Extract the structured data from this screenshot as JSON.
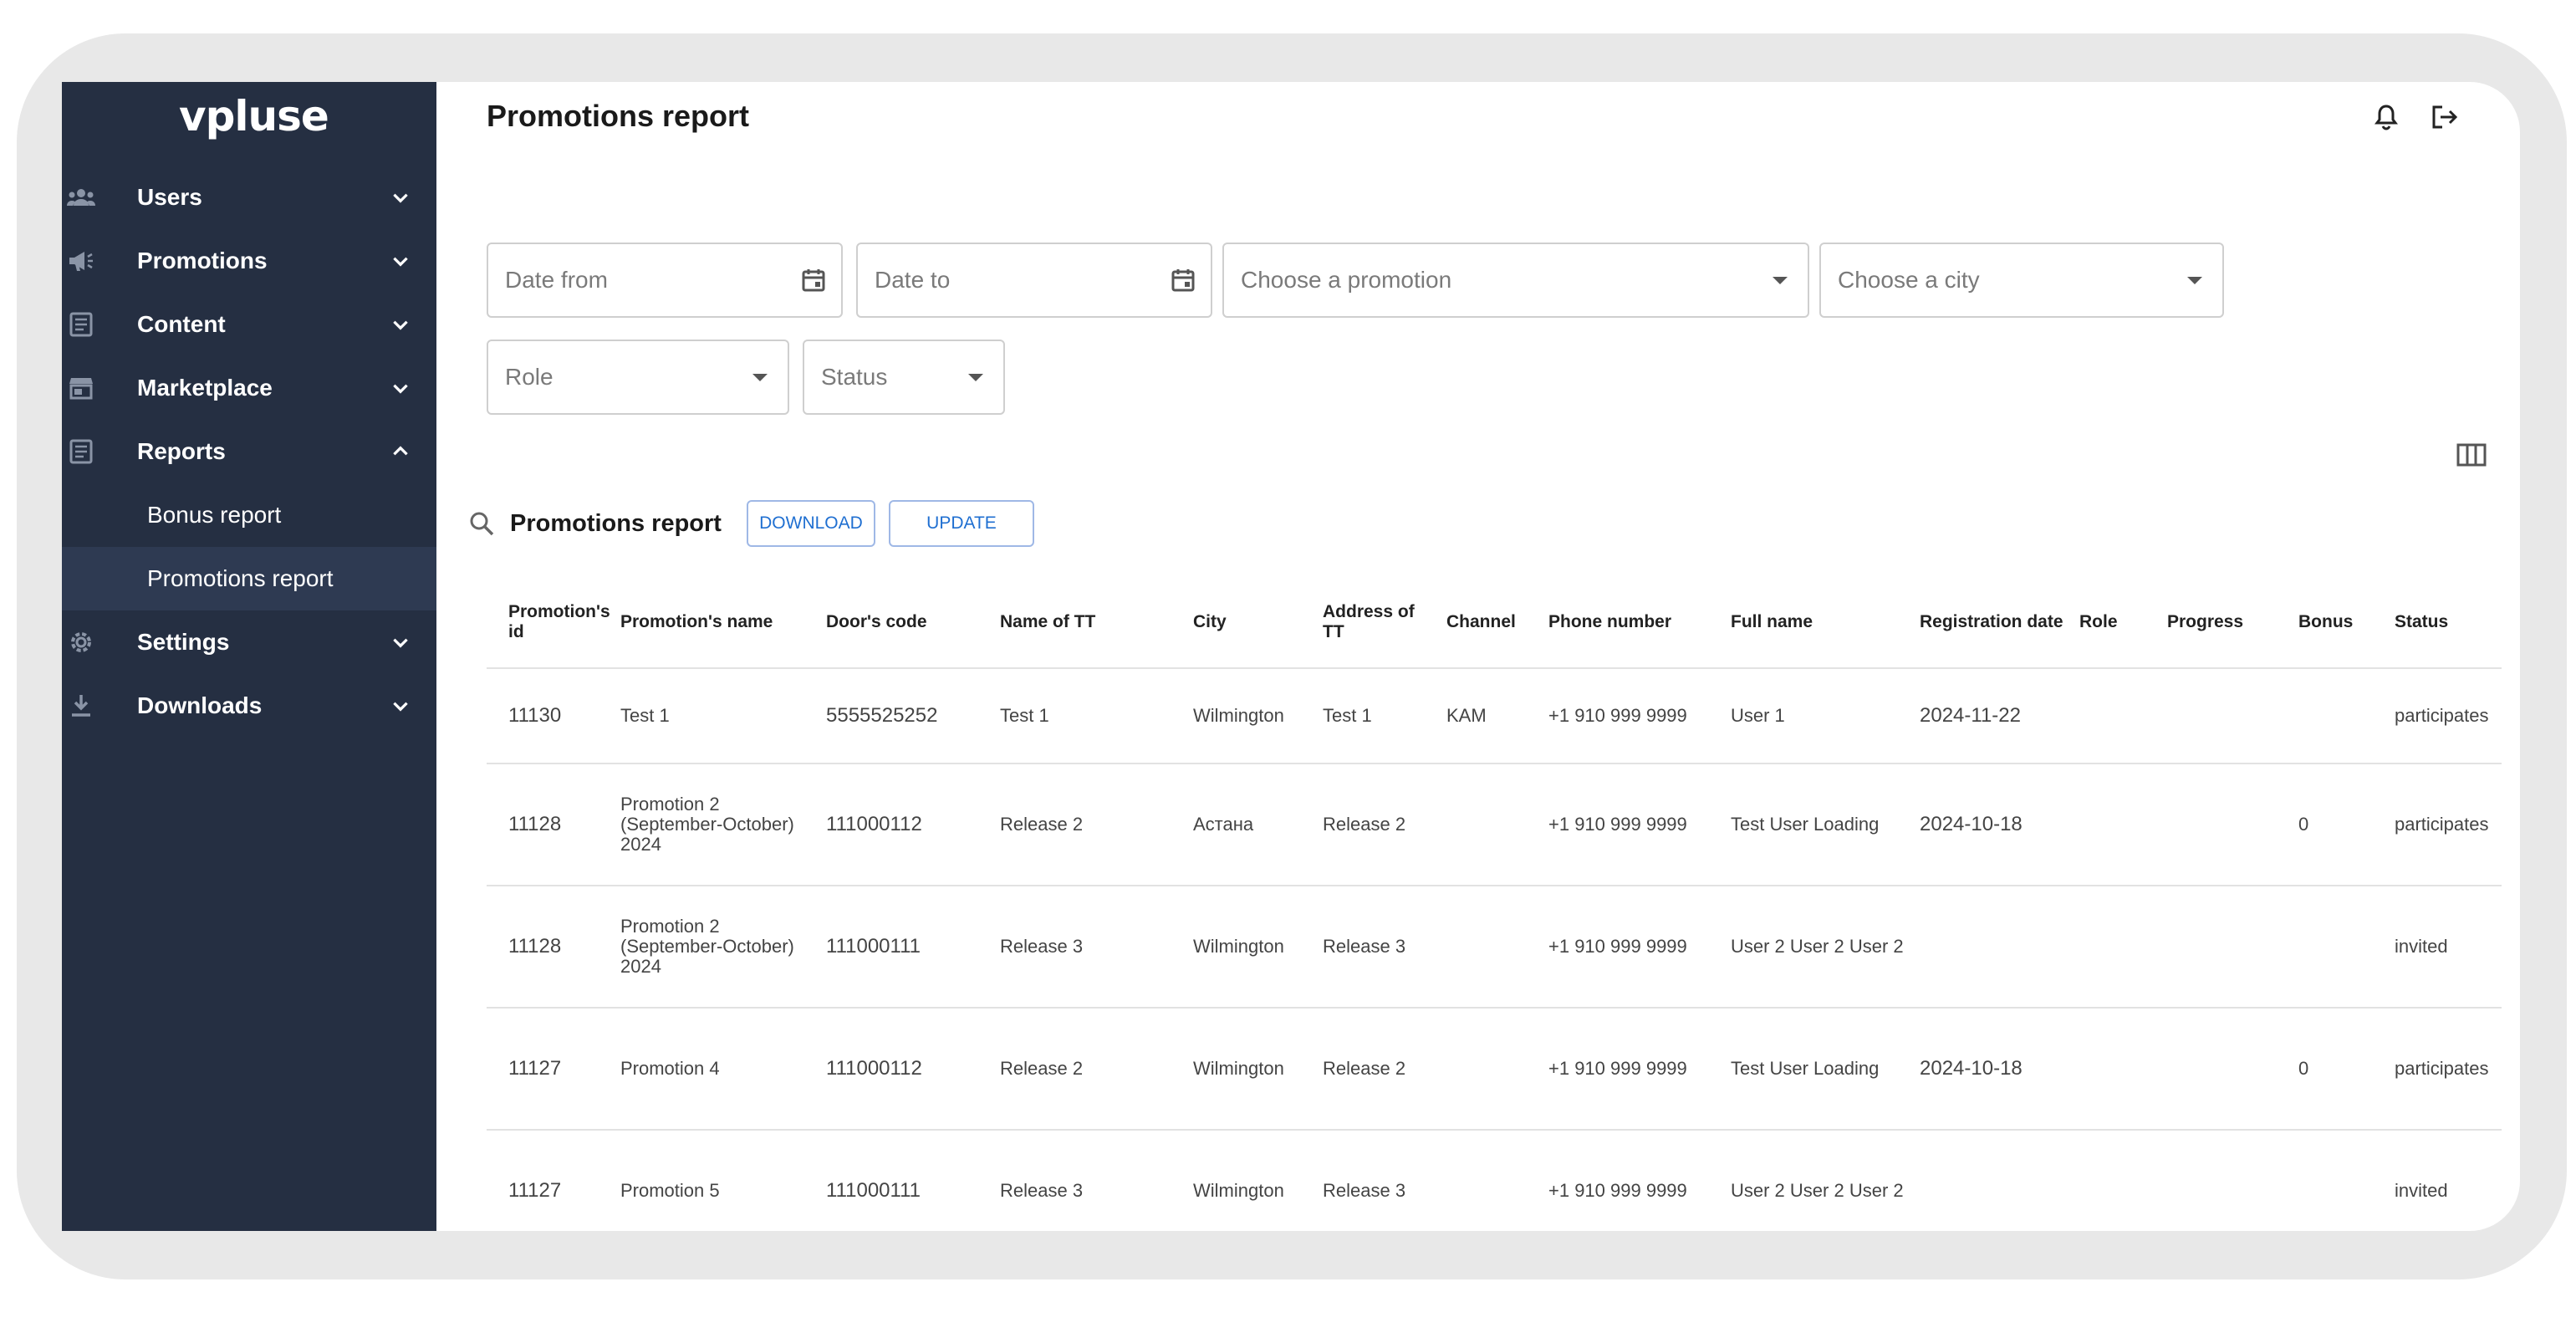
{
  "brand": {
    "logo": "vpluse"
  },
  "sidebar": {
    "items": [
      {
        "label": "Users",
        "icon": "users-icon",
        "expanded": false
      },
      {
        "label": "Promotions",
        "icon": "megaphone-icon",
        "expanded": false
      },
      {
        "label": "Content",
        "icon": "document-icon",
        "expanded": false
      },
      {
        "label": "Marketplace",
        "icon": "store-icon",
        "expanded": false
      },
      {
        "label": "Reports",
        "icon": "report-icon",
        "expanded": true
      },
      {
        "label": "Settings",
        "icon": "gear-icon",
        "expanded": false
      },
      {
        "label": "Downloads",
        "icon": "download-icon",
        "expanded": false
      }
    ],
    "reports_sub": [
      {
        "label": "Bonus report",
        "active": false
      },
      {
        "label": "Promotions report",
        "active": true
      }
    ]
  },
  "header": {
    "title": "Promotions report",
    "icons": [
      "bell-icon",
      "logout-icon"
    ]
  },
  "filters": {
    "date_from": "Date from",
    "date_to": "Date to",
    "promotion": "Choose a promotion",
    "city": "Choose a city",
    "role": "Role",
    "status": "Status"
  },
  "toolbar": {
    "title": "Promotions report",
    "download_label": "DOWNLOAD",
    "update_label": "UPDATE"
  },
  "table": {
    "columns": [
      "Promotion's id",
      "Promotion's name",
      "Door's code",
      "Name of TT",
      "City",
      "Address of TT",
      "Channel",
      "Phone number",
      "Full name",
      "Registration date",
      "Role",
      "Progress",
      "Bonus",
      "Status"
    ],
    "rows": [
      [
        "11130",
        "Test 1",
        "5555525252",
        "Test 1",
        "Wilmington",
        "Test 1",
        "KAM",
        "+1 910 999 9999",
        "User 1",
        "2024-11-22",
        "",
        "",
        "",
        "participates"
      ],
      [
        "11128",
        "Promotion 2 (September-October) 2024",
        "111000112",
        "Release 2",
        "Астана",
        "Release 2",
        "",
        "+1 910 999 9999",
        "Test User Loading",
        "2024-10-18",
        "",
        "",
        "0",
        "participates"
      ],
      [
        "11128",
        "Promotion 2 (September-October) 2024",
        "111000111",
        "Release 3",
        "Wilmington",
        "Release 3",
        "",
        "+1 910 999 9999",
        "User 2 User 2 User 2",
        "",
        "",
        "",
        "",
        "invited"
      ],
      [
        "11127",
        "Promotion 4",
        "111000112",
        "Release 2",
        "Wilmington",
        "Release 2",
        "",
        "+1 910 999 9999",
        "Test User Loading",
        "2024-10-18",
        "",
        "",
        "0",
        "participates"
      ],
      [
        "11127",
        "Promotion 5",
        "111000111",
        "Release 3",
        "Wilmington",
        "Release 3",
        "",
        "+1 910 999 9999",
        "User 2 User 2 User 2",
        "",
        "",
        "",
        "",
        "invited"
      ]
    ]
  }
}
